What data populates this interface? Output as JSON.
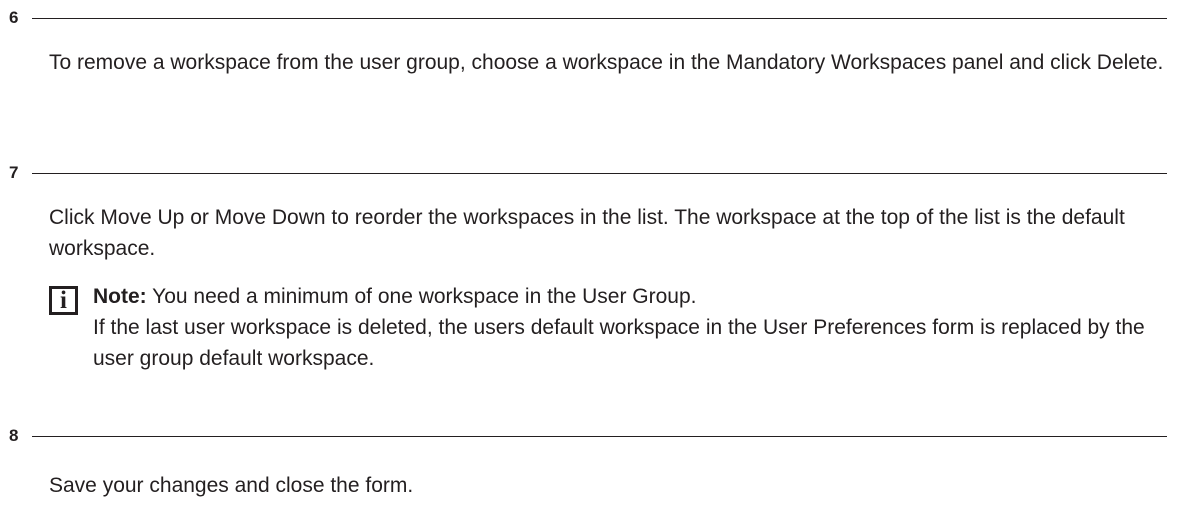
{
  "steps": [
    {
      "number": "6",
      "text": "To remove a workspace from the user group, choose a workspace in the Mandatory Workspaces panel and click Delete."
    },
    {
      "number": "7",
      "text": "Click Move Up or Move Down to reorder the workspaces in the list. The workspace at the top of the list is the default workspace.",
      "note": {
        "icon": "info-icon",
        "icon_glyph": "i",
        "label": "Note:",
        "line1": "You need a minimum of one workspace in the User Group.",
        "line2": "If the last user workspace is deleted, the users default workspace in the User Preferences form is replaced by the user group default workspace."
      }
    },
    {
      "number": "8",
      "text": "Save your changes and close the form."
    }
  ]
}
